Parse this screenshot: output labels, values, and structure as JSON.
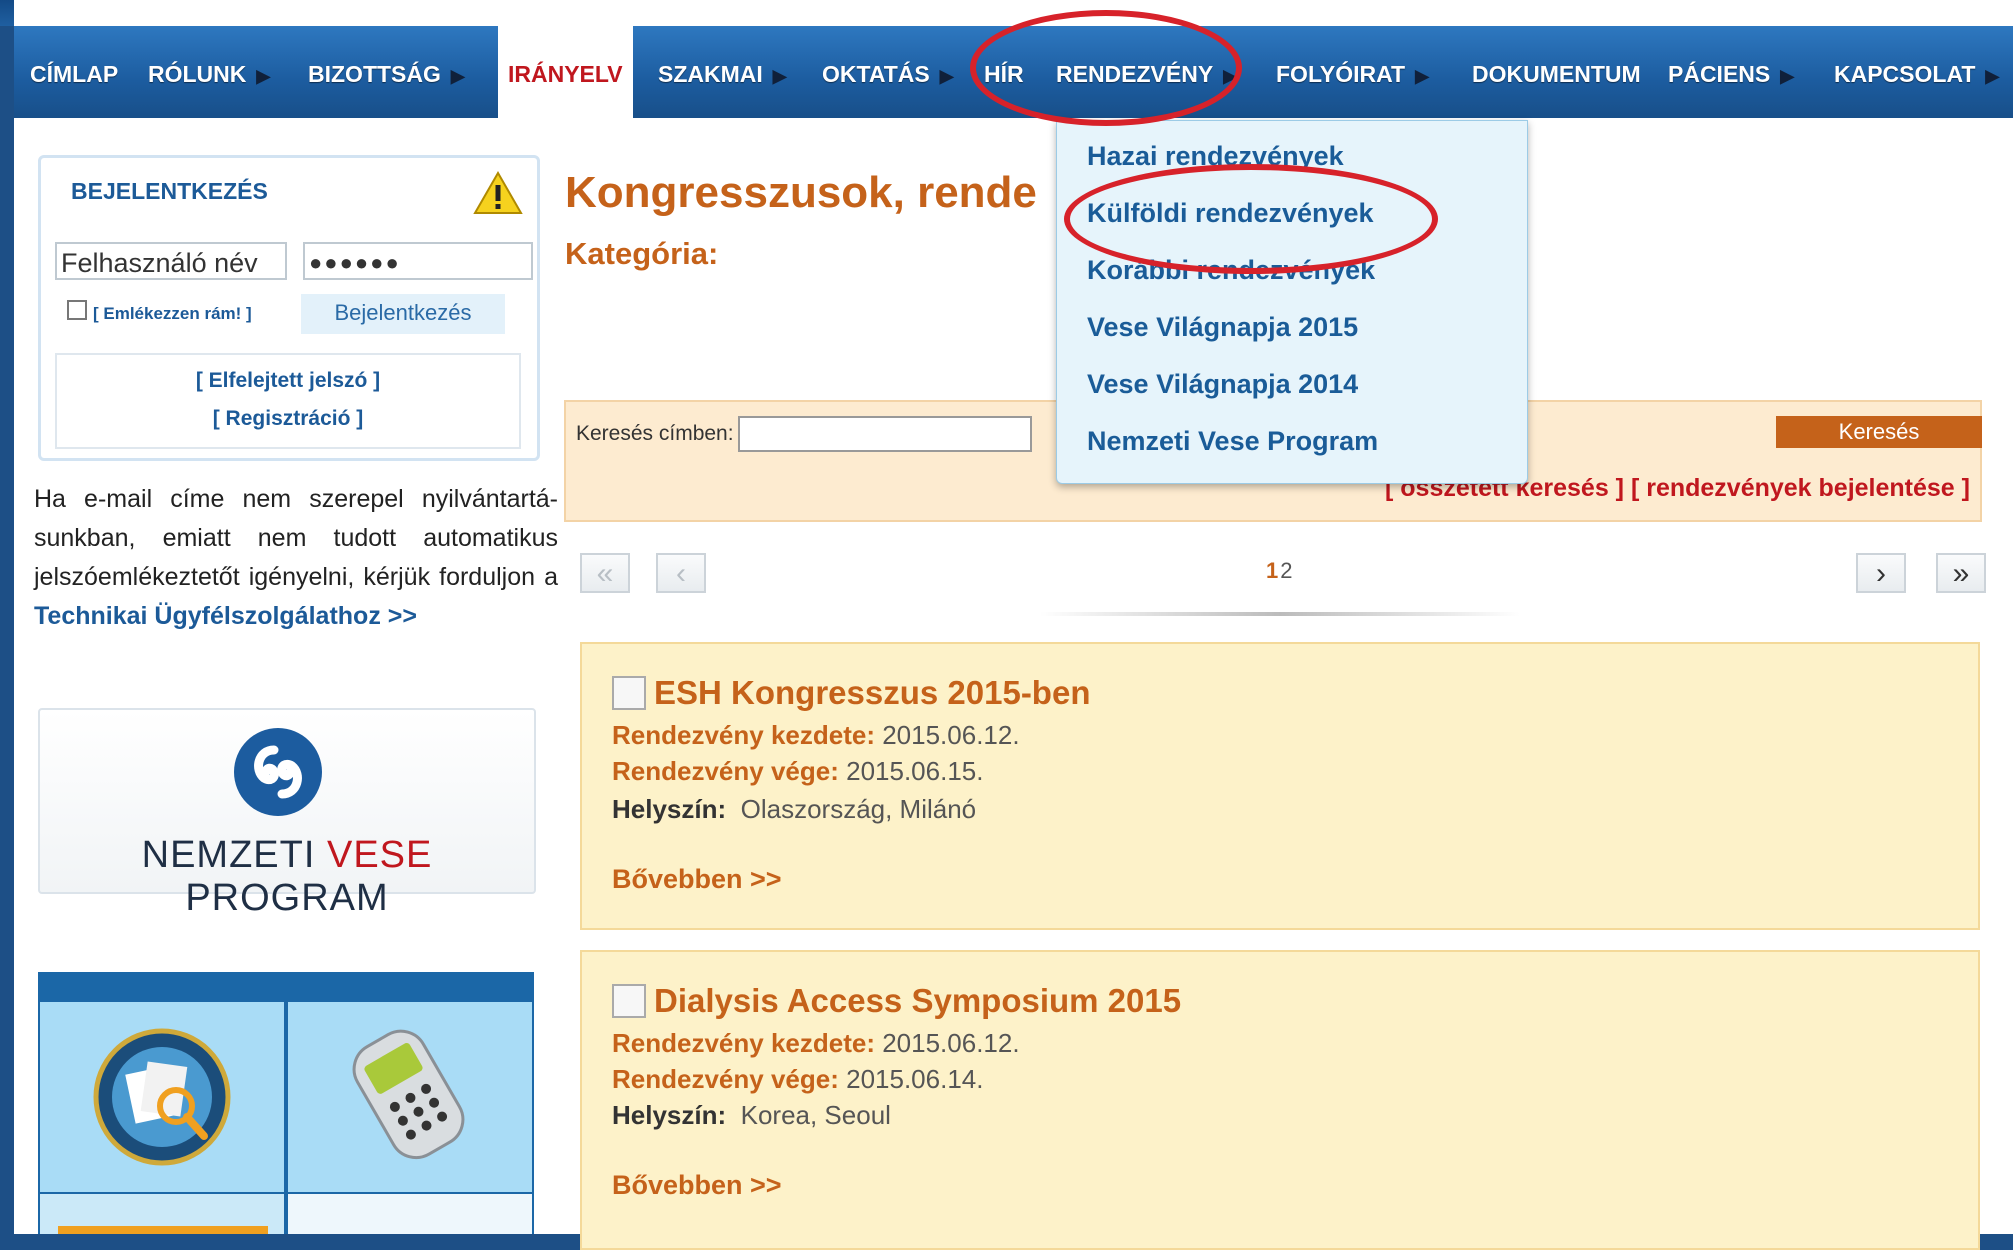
{
  "nav": [
    {
      "label": "Címlap",
      "arrow": false
    },
    {
      "label": "Rólunk",
      "arrow": true
    },
    {
      "label": "Bizottság",
      "arrow": true
    },
    {
      "label": "Irányelv",
      "arrow": false,
      "active": true
    },
    {
      "label": "Szakmai",
      "arrow": true
    },
    {
      "label": "Oktatás",
      "arrow": true
    },
    {
      "label": "Hír",
      "arrow": false
    },
    {
      "label": "Rendezvény",
      "arrow": true
    },
    {
      "label": "Folyóirat",
      "arrow": true
    },
    {
      "label": "Dokumentum",
      "arrow": false
    },
    {
      "label": "Páciens",
      "arrow": true
    },
    {
      "label": "Kapcsolat",
      "arrow": true
    }
  ],
  "dropdown": [
    "Hazai rendezvények",
    "Külföldi rendezvények",
    "Korábbi rendezvények",
    "Vese Világnapja 2015",
    "Vese Világnapja 2014",
    "Nemzeti Vese Program"
  ],
  "login": {
    "title": "BEJELENTKEZÉS",
    "username_placeholder": "Felhasználó név",
    "password_value": "●●●●●●",
    "remember": "[ Emlékezzen rám! ]",
    "button": "Bejelentkezés",
    "forgot": "[ Elfelejtett jelszó ]",
    "register": "[ Regisztráció ]"
  },
  "info": {
    "text": "Ha e-mail címe nem szerepel nyilvántartá-sunkban, emiatt nem tudott automatikus jelszóemlékeztetőt igényelni, kérjük forduljon a ",
    "link": "Technikai Ügyfélszolgálathoz >>"
  },
  "nvp": {
    "part1": "NEMZETI ",
    "part2": "VESE",
    "part3": " PROGRAM"
  },
  "main": {
    "title": "Kongresszusok, rende",
    "category": "Kategória:"
  },
  "search": {
    "label": "Keresés címben:",
    "button": "Keresés",
    "links": "[ összetett keresés ] [ rendezvények bejelentése ]"
  },
  "pagination": {
    "first": "«",
    "prev": "‹",
    "current": "1",
    "other": "2",
    "next": "›",
    "last": "»"
  },
  "events": [
    {
      "title": "ESH Kongresszus 2015-ben",
      "start_label": "Rendezvény kezdete:",
      "start": "2015.06.12.",
      "end_label": "Rendezvény vége:",
      "end": "2015.06.15.",
      "place_label": "Helyszín:",
      "place": "Olaszország, Milánó",
      "more": "Bővebben >>"
    },
    {
      "title": "Dialysis Access Symposium 2015",
      "start_label": "Rendezvény kezdete:",
      "start": "2015.06.12.",
      "end_label": "Rendezvény vége:",
      "end": "2015.06.14.",
      "place_label": "Helyszín:",
      "place": "Korea, Seoul",
      "more": "Bővebben >>"
    }
  ],
  "colors": {
    "accent": "#c5621a",
    "nav": "#1c5c9f",
    "highlight": "#d7222a"
  }
}
